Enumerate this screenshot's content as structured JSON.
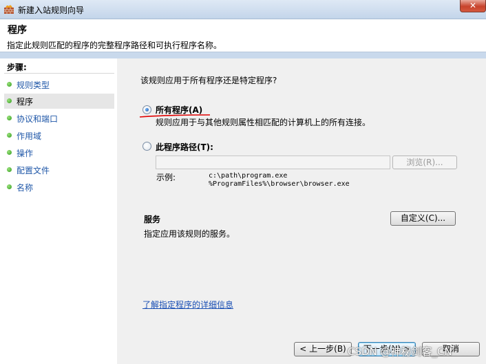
{
  "window": {
    "title": "新建入站规则向导",
    "close_label": "✕"
  },
  "header": {
    "title": "程序",
    "subtitle": "指定此规则匹配的程序的完整程序路径和可执行程序名称。"
  },
  "sidebar": {
    "heading": "步骤:",
    "items": [
      {
        "label": "规则类型",
        "active": false
      },
      {
        "label": "程序",
        "active": true
      },
      {
        "label": "协议和端口",
        "active": false
      },
      {
        "label": "作用域",
        "active": false
      },
      {
        "label": "操作",
        "active": false
      },
      {
        "label": "配置文件",
        "active": false
      },
      {
        "label": "名称",
        "active": false
      }
    ]
  },
  "main": {
    "question": "该规则应用于所有程序还是特定程序?",
    "option_all": {
      "label": "所有程序(A)",
      "description": "规则应用于与其他规则属性相匹配的计算机上的所有连接。",
      "checked": true
    },
    "option_path": {
      "label": "此程序路径(T):",
      "value": "",
      "checked": false
    },
    "browse_label": "浏览(R)...",
    "example_label": "示例:",
    "examples": [
      "c:\\path\\program.exe",
      "%ProgramFiles%\\browser\\browser.exe"
    ],
    "services": {
      "heading": "服务",
      "description": "指定应用该规则的服务。",
      "customize_label": "自定义(C)..."
    },
    "learn_more": "了解指定程序的详细信息"
  },
  "footer": {
    "back_label": "< 上一步(B)",
    "next_label": "下一步(N) >",
    "cancel_label": "取消"
  },
  "watermark": "CSDN @神秘剑客_CN",
  "colors": {
    "link": "#1a4fb4",
    "annotation_red": "#e00000",
    "step_dot": "#2f9a1c"
  }
}
